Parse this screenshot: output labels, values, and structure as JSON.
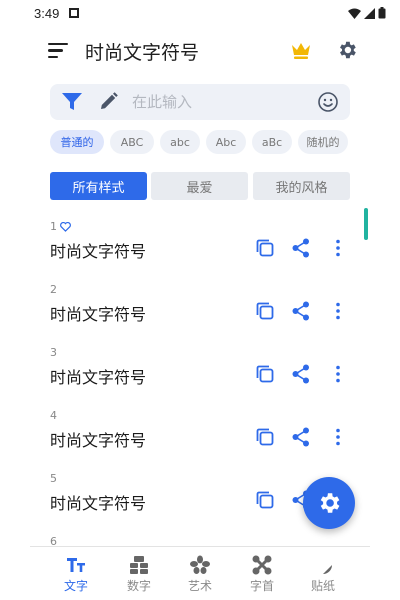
{
  "status_bar": {
    "time": "3:49"
  },
  "app_bar": {
    "title": "时尚文字符号"
  },
  "search": {
    "placeholder": "在此输入"
  },
  "chips": [
    {
      "label": "普通的",
      "active": true
    },
    {
      "label": "ABC",
      "active": false
    },
    {
      "label": "abc",
      "active": false
    },
    {
      "label": "Abc",
      "active": false
    },
    {
      "label": "aBc",
      "active": false
    },
    {
      "label": "随机的",
      "active": false
    }
  ],
  "segments": [
    {
      "label": "所有样式",
      "active": true
    },
    {
      "label": "最爱",
      "active": false
    },
    {
      "label": "我的风格",
      "active": false
    }
  ],
  "styles": [
    {
      "number": "1",
      "text": "时尚文字符号",
      "favorite": true
    },
    {
      "number": "2",
      "text": "时尚文字符号",
      "favorite": false
    },
    {
      "number": "3",
      "text": "时尚文字符号",
      "favorite": false
    },
    {
      "number": "4",
      "text": "时尚文字符号",
      "favorite": false
    },
    {
      "number": "5",
      "text": "时尚文字符号",
      "favorite": false
    },
    {
      "number": "6",
      "text": "",
      "favorite": false
    }
  ],
  "bottom_nav": [
    {
      "label": "文字",
      "icon": "text-size-icon",
      "active": true
    },
    {
      "label": "数字",
      "icon": "numbers-icon",
      "active": false
    },
    {
      "label": "艺术",
      "icon": "art-flower-icon",
      "active": false
    },
    {
      "label": "字首",
      "icon": "initials-icon",
      "active": false
    },
    {
      "label": "贴纸",
      "icon": "sticker-icon",
      "active": false
    }
  ],
  "colors": {
    "accent": "#2e6ae9",
    "crown": "#f2b705",
    "scroll_thumb": "#21b3a0",
    "chip_active_bg": "#dfe6fb",
    "search_bg": "#eef1f7"
  }
}
